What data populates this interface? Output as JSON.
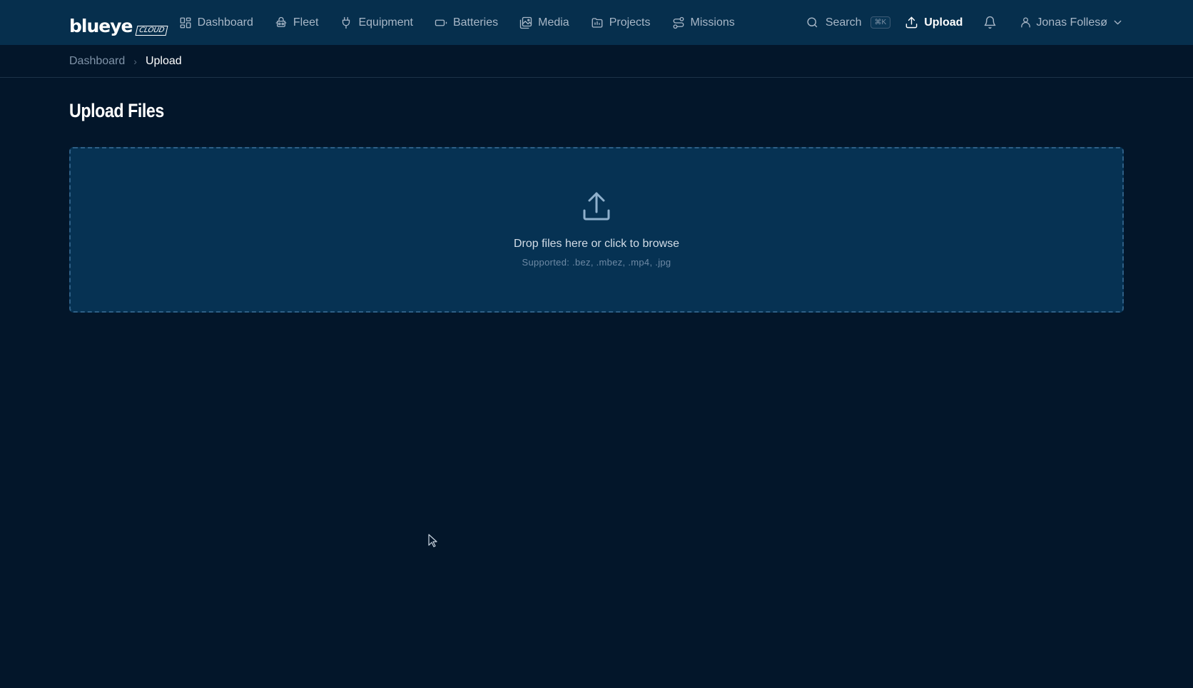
{
  "app": {
    "logo_word": "blueye",
    "logo_sub": "CLOUD"
  },
  "nav": {
    "items": [
      {
        "label": "Dashboard",
        "icon": "grid-icon"
      },
      {
        "label": "Fleet",
        "icon": "drone-icon"
      },
      {
        "label": "Equipment",
        "icon": "plug-icon"
      },
      {
        "label": "Batteries",
        "icon": "battery-icon"
      },
      {
        "label": "Media",
        "icon": "image-icon"
      },
      {
        "label": "Projects",
        "icon": "folder-icon"
      },
      {
        "label": "Missions",
        "icon": "route-icon"
      }
    ]
  },
  "header": {
    "search_label": "Search",
    "search_shortcut": "⌘K",
    "upload_label": "Upload",
    "user_name": "Jonas Follesø"
  },
  "breadcrumb": {
    "parent": "Dashboard",
    "current": "Upload"
  },
  "page": {
    "title": "Upload Files"
  },
  "dropzone": {
    "title": "Drop files here or click to browse",
    "supported": "Supported: .bez, .mbez, .mp4, .jpg"
  },
  "colors": {
    "topbar": "#062f4d",
    "background": "#03162a",
    "dropzone": "#063253",
    "dropzone_border": "#2e5f86"
  }
}
